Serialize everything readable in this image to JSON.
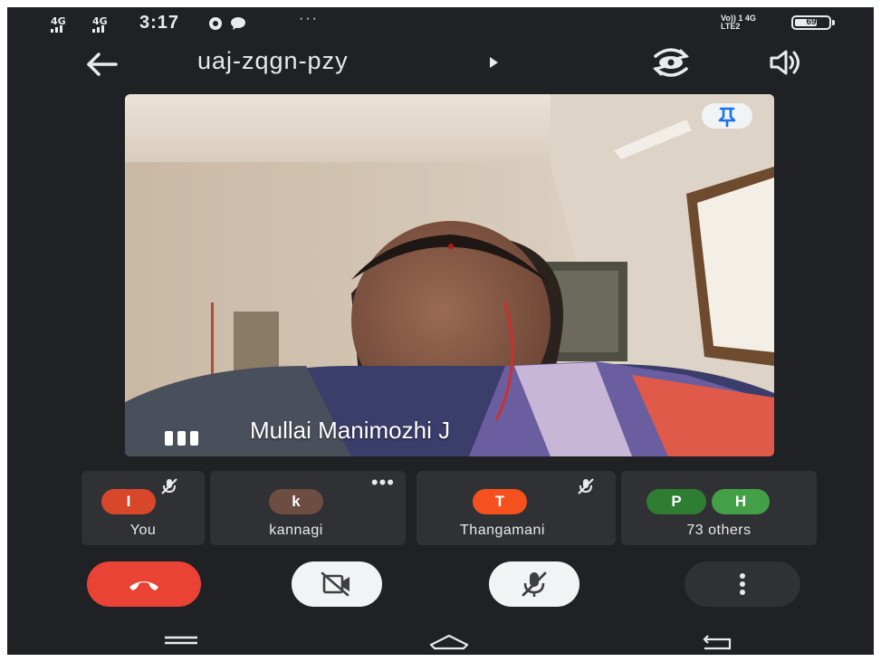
{
  "status_bar": {
    "network_1": "4G",
    "network_2": "4G",
    "time": "3:17",
    "more_indicator": "···",
    "right_top": "Vo)) 1 4G",
    "right_bottom": "LTE2",
    "battery_level": 69,
    "battery_text": "69"
  },
  "top_bar": {
    "meeting_code": "uaj-zqgn-pzy",
    "icons": [
      "back-arrow-icon",
      "play-arrow-icon",
      "switch-camera-icon",
      "speaker-icon"
    ]
  },
  "main_video": {
    "participant_name": "Mullai Manimozhi J",
    "pin_icon": "pin-icon",
    "speaking_icon": "audio-level-icon"
  },
  "participants": [
    {
      "initial": "I",
      "label": "You",
      "avatar_color": "#d9472b",
      "mic_muted": true
    },
    {
      "initial": "k",
      "label": "kannagi",
      "avatar_color": "#6d4c41",
      "mic_muted": false
    },
    {
      "initial": "T",
      "label": "Thangamani",
      "avatar_color": "#f4511e",
      "mic_muted": true
    },
    {
      "initial_1": "P",
      "initial_2": "H",
      "label": "73 others",
      "avatar_color_1": "#2e7d32",
      "avatar_color_2": "#43a047"
    }
  ],
  "controls": {
    "end_call_color": "#ea4335",
    "icons": [
      "end-call-icon",
      "camera-off-icon",
      "mic-off-icon",
      "more-vert-icon"
    ]
  },
  "nav_bar": {
    "icons": [
      "menu-icon",
      "home-icon",
      "back-icon"
    ]
  }
}
